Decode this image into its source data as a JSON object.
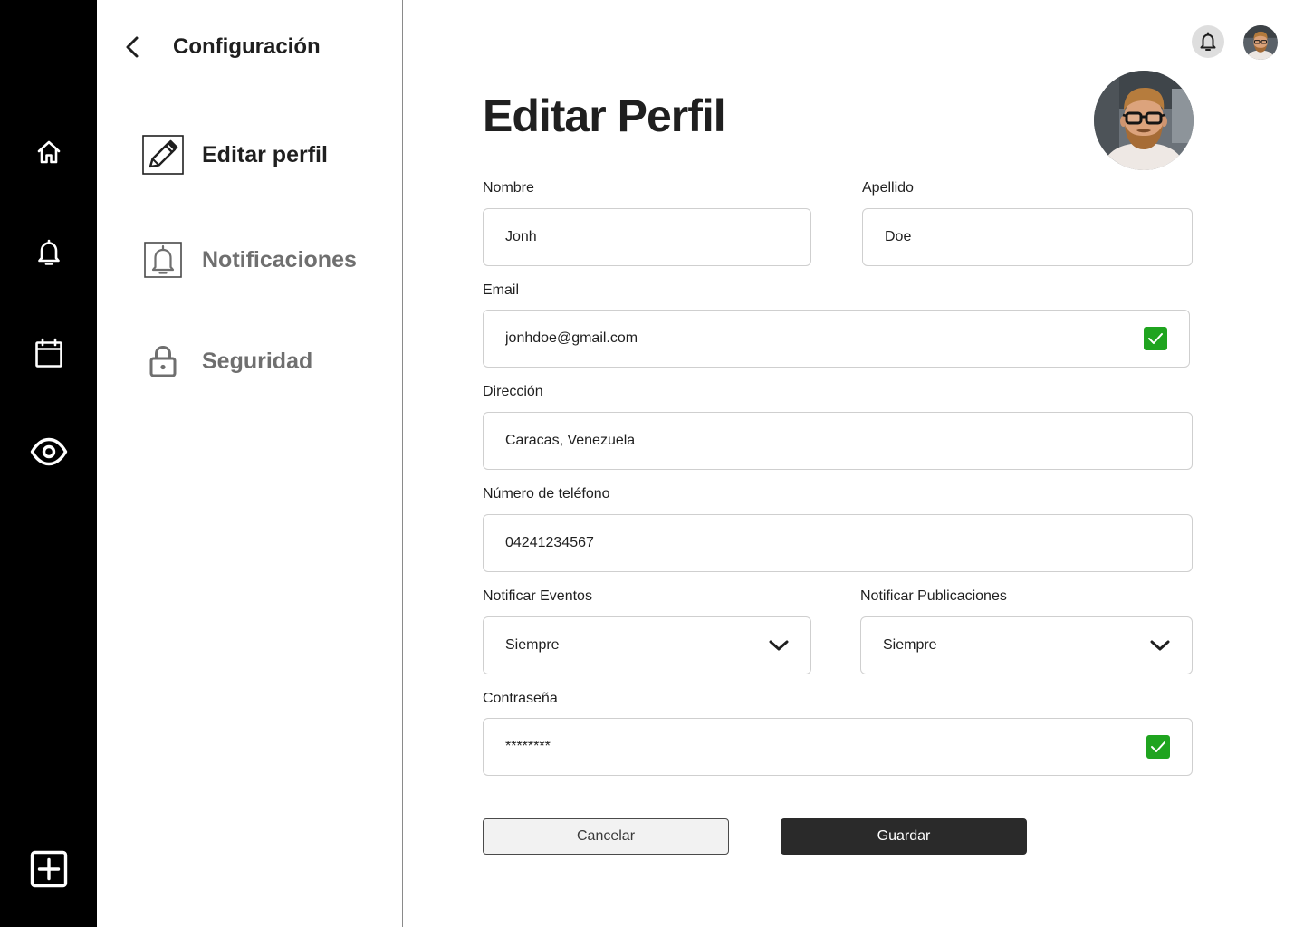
{
  "rail": {
    "icons": [
      "home-icon",
      "bell-icon",
      "calendar-icon",
      "eye-icon",
      "plus-square-icon"
    ],
    "background": "#000000"
  },
  "settings": {
    "title": "Configuración",
    "items": [
      {
        "label": "Editar perfil",
        "icon": "pencil-icon",
        "active": true
      },
      {
        "label": "Notificaciones",
        "icon": "bell-icon",
        "active": false
      },
      {
        "label": "Seguridad",
        "icon": "lock-icon",
        "active": false
      }
    ]
  },
  "header": {
    "icons": [
      "bell-icon",
      "avatar"
    ]
  },
  "form": {
    "title": "Editar Perfil",
    "first_name": {
      "label": "Nombre",
      "value": "Jonh"
    },
    "last_name": {
      "label": "Apellido",
      "value": "Doe"
    },
    "email": {
      "label": "Email",
      "value": "jonhdoe@gmail.com",
      "verified": true
    },
    "address": {
      "label": "Dirección",
      "value": "Caracas, Venezuela"
    },
    "phone": {
      "label": "Número de teléfono",
      "value": "04241234567"
    },
    "notify_events": {
      "label": "Notificar Eventos",
      "value": "Siempre"
    },
    "notify_posts": {
      "label": "Notificar Publicaciones",
      "value": "Siempre"
    },
    "password": {
      "label": "Contraseña",
      "value": "********",
      "verified": true
    },
    "cancel_label": "Cancelar",
    "save_label": "Guardar"
  },
  "colors": {
    "check_green": "#1fa41f",
    "save_button": "#2a2a2a"
  }
}
